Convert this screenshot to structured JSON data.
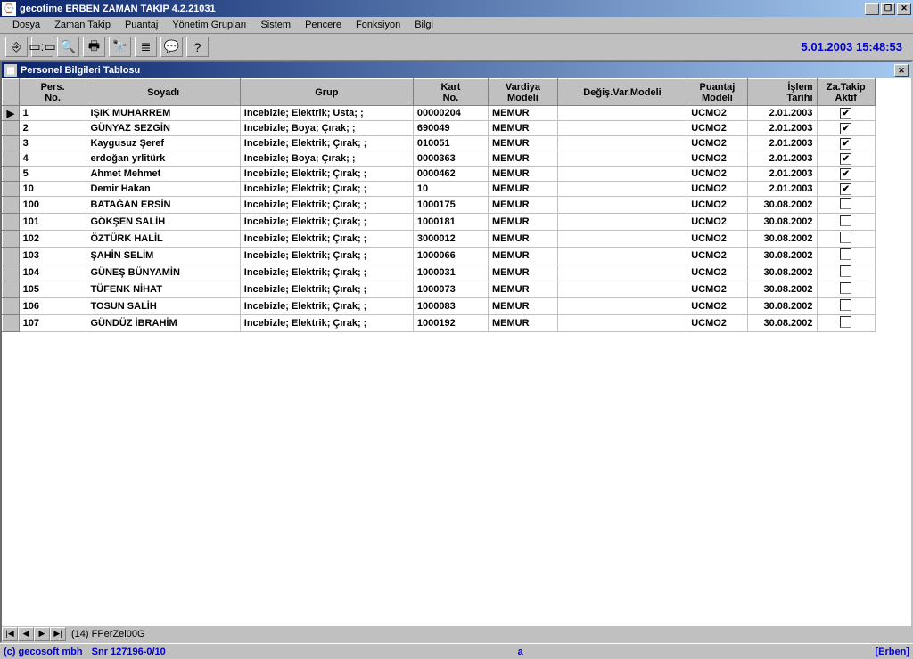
{
  "title": "gecotime  ERBEN ZAMAN TAKIP  4.2.21031",
  "menu": [
    "Dosya",
    "Zaman Takip",
    "Puantaj",
    "Yönetim Grupları",
    "Sistem",
    "Pencere",
    "Fonksiyon",
    "Bilgi"
  ],
  "datetime": "5.01.2003  15:48:53",
  "child_title": "Personel Bilgileri Tablosu",
  "columns": [
    "Pers.\nNo.",
    "Soyadı",
    "Grup",
    "Kart\nNo.",
    "Vardiya\nModeli",
    "Değiş.Var.Modeli",
    "Puantaj\nModeli",
    "İşlem\nTarihi",
    "Za.Takip\nAktif"
  ],
  "rows": [
    {
      "sel": "▶",
      "pers": "1",
      "soy": "IŞIK MUHARREM",
      "grup": "Incebizle; Elektrik; Usta; ;",
      "kart": "00000204",
      "vard": "MEMUR",
      "degis": "",
      "puan": "UCMO2",
      "tarih": "2.01.2003",
      "aktif": true
    },
    {
      "sel": "",
      "pers": "2",
      "soy": "GÜNYAZ SEZGİN",
      "grup": "Incebizle; Boya; Çırak; ;",
      "kart": "690049",
      "vard": "MEMUR",
      "degis": "",
      "puan": "UCMO2",
      "tarih": "2.01.2003",
      "aktif": true
    },
    {
      "sel": "",
      "pers": "3",
      "soy": "Kaygusuz Şeref",
      "grup": "Incebizle; Elektrik; Çırak; ;",
      "kart": "010051",
      "vard": "MEMUR",
      "degis": "",
      "puan": "UCMO2",
      "tarih": "2.01.2003",
      "aktif": true
    },
    {
      "sel": "",
      "pers": "4",
      "soy": "erdoğan yrlitürk",
      "grup": "Incebizle; Boya; Çırak; ;",
      "kart": "0000363",
      "vard": "MEMUR",
      "degis": "",
      "puan": "UCMO2",
      "tarih": "2.01.2003",
      "aktif": true
    },
    {
      "sel": "",
      "pers": "5",
      "soy": "Ahmet Mehmet",
      "grup": "Incebizle; Elektrik; Çırak; ;",
      "kart": "0000462",
      "vard": "MEMUR",
      "degis": "",
      "puan": "UCMO2",
      "tarih": "2.01.2003",
      "aktif": true
    },
    {
      "sel": "",
      "pers": "10",
      "soy": "Demir Hakan",
      "grup": "Incebizle; Elektrik; Çırak; ;",
      "kart": "10",
      "vard": "MEMUR",
      "degis": "",
      "puan": "UCMO2",
      "tarih": "2.01.2003",
      "aktif": true
    },
    {
      "sel": "",
      "pers": "100",
      "soy": "BATAĞAN ERSİN",
      "grup": "Incebizle; Elektrik; Çırak; ;",
      "kart": "1000175",
      "vard": "MEMUR",
      "degis": "",
      "puan": "UCMO2",
      "tarih": "30.08.2002",
      "aktif": false
    },
    {
      "sel": "",
      "pers": "101",
      "soy": "GÖKŞEN SALİH",
      "grup": "Incebizle; Elektrik; Çırak; ;",
      "kart": "1000181",
      "vard": "MEMUR",
      "degis": "",
      "puan": "UCMO2",
      "tarih": "30.08.2002",
      "aktif": false
    },
    {
      "sel": "",
      "pers": "102",
      "soy": "ÖZTÜRK HALİL",
      "grup": "Incebizle; Elektrik; Çırak; ;",
      "kart": "3000012",
      "vard": "MEMUR",
      "degis": "",
      "puan": "UCMO2",
      "tarih": "30.08.2002",
      "aktif": false
    },
    {
      "sel": "",
      "pers": "103",
      "soy": "ŞAHİN SELİM",
      "grup": "Incebizle; Elektrik; Çırak; ;",
      "kart": "1000066",
      "vard": "MEMUR",
      "degis": "",
      "puan": "UCMO2",
      "tarih": "30.08.2002",
      "aktif": false
    },
    {
      "sel": "",
      "pers": "104",
      "soy": "GÜNEŞ BÜNYAMİN",
      "grup": "Incebizle; Elektrik; Çırak; ;",
      "kart": "1000031",
      "vard": "MEMUR",
      "degis": "",
      "puan": "UCMO2",
      "tarih": "30.08.2002",
      "aktif": false
    },
    {
      "sel": "",
      "pers": "105",
      "soy": "TÜFENK NİHAT",
      "grup": "Incebizle; Elektrik; Çırak; ;",
      "kart": "1000073",
      "vard": "MEMUR",
      "degis": "",
      "puan": "UCMO2",
      "tarih": "30.08.2002",
      "aktif": false
    },
    {
      "sel": "",
      "pers": "106",
      "soy": "TOSUN SALİH",
      "grup": "Incebizle; Elektrik; Çırak; ;",
      "kart": "1000083",
      "vard": "MEMUR",
      "degis": "",
      "puan": "UCMO2",
      "tarih": "30.08.2002",
      "aktif": false
    },
    {
      "sel": "",
      "pers": "107",
      "soy": "GÜNDÜZ İBRAHİM",
      "grup": "Incebizle; Elektrik; Çırak; ;",
      "kart": "1000192",
      "vard": "MEMUR",
      "degis": "",
      "puan": "UCMO2",
      "tarih": "30.08.2002",
      "aktif": false
    }
  ],
  "nav_info": "(14)  FPerZei00G",
  "status": {
    "copyright": "(c) gecosoft mbh",
    "snr": "Snr 127196-0/10",
    "mid": "a",
    "user": "[Erben]"
  },
  "toolbar_icons": [
    "⎆",
    "▭:▭",
    "🔍",
    "🖶",
    "🔭",
    "≣",
    "💬",
    "?"
  ]
}
